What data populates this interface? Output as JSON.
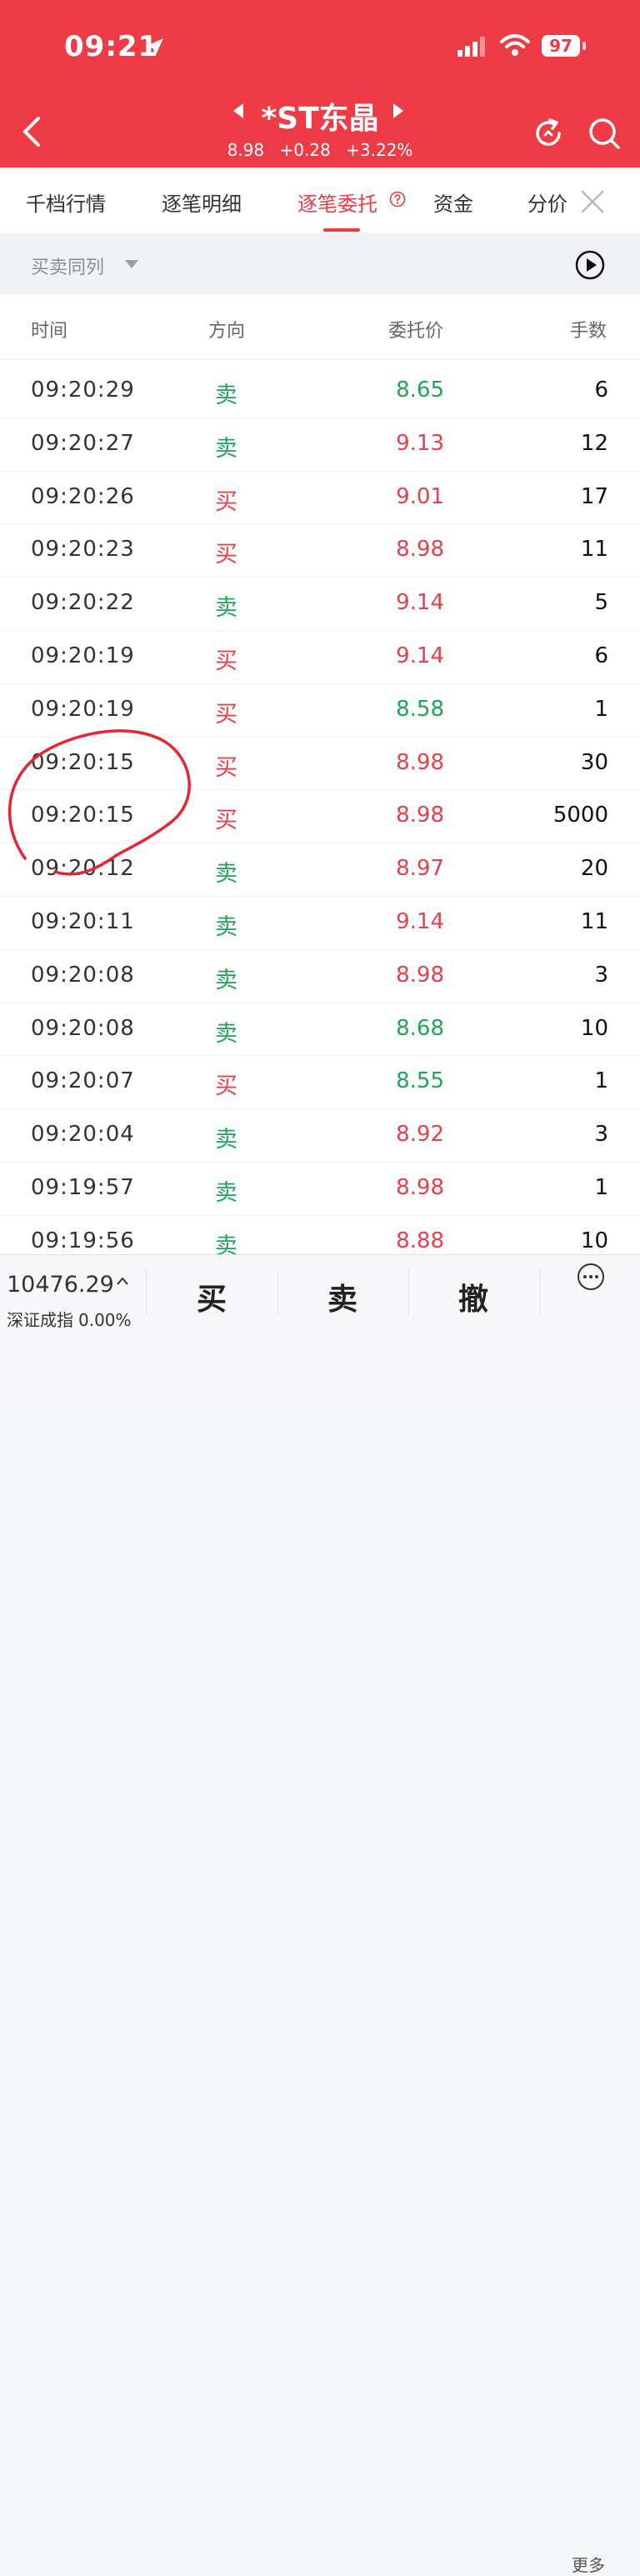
{
  "status": {
    "time": "09:21",
    "battery": "97"
  },
  "header": {
    "stock_name": "*ST东晶",
    "price": "8.98",
    "change": "+0.28",
    "change_pct": "+3.22%"
  },
  "tabs": [
    {
      "label": "千档行情"
    },
    {
      "label": "逐笔明细"
    },
    {
      "label": "逐笔委托"
    },
    {
      "label": "资金"
    },
    {
      "label": "分价"
    }
  ],
  "filter": {
    "label": "买卖同列"
  },
  "table": {
    "headers": {
      "time": "时间",
      "direction": "方向",
      "price": "委托价",
      "quantity": "手数"
    },
    "rows": [
      {
        "time": "09:20:29",
        "direction": "卖",
        "price": "8.65",
        "quantity": "6"
      },
      {
        "time": "09:20:27",
        "direction": "卖",
        "price": "9.13",
        "quantity": "12"
      },
      {
        "time": "09:20:26",
        "direction": "买",
        "price": "9.01",
        "quantity": "17"
      },
      {
        "time": "09:20:23",
        "direction": "买",
        "price": "8.98",
        "quantity": "11"
      },
      {
        "time": "09:20:22",
        "direction": "卖",
        "price": "9.14",
        "quantity": "5"
      },
      {
        "time": "09:20:19",
        "direction": "买",
        "price": "9.14",
        "quantity": "6"
      },
      {
        "time": "09:20:19",
        "direction": "买",
        "price": "8.58",
        "quantity": "1"
      },
      {
        "time": "09:20:15",
        "direction": "买",
        "price": "8.98",
        "quantity": "30"
      },
      {
        "time": "09:20:15",
        "direction": "买",
        "price": "8.98",
        "quantity": "5000"
      },
      {
        "time": "09:20:12",
        "direction": "卖",
        "price": "8.97",
        "quantity": "20"
      },
      {
        "time": "09:20:11",
        "direction": "卖",
        "price": "9.14",
        "quantity": "11"
      },
      {
        "time": "09:20:08",
        "direction": "卖",
        "price": "8.98",
        "quantity": "3"
      },
      {
        "time": "09:20:08",
        "direction": "卖",
        "price": "8.68",
        "quantity": "10"
      },
      {
        "time": "09:20:07",
        "direction": "买",
        "price": "8.55",
        "quantity": "1"
      },
      {
        "time": "09:20:04",
        "direction": "卖",
        "price": "8.92",
        "quantity": "3"
      },
      {
        "time": "09:19:57",
        "direction": "卖",
        "price": "8.98",
        "quantity": "1"
      },
      {
        "time": "09:19:56",
        "direction": "卖",
        "price": "8.88",
        "quantity": "10"
      }
    ]
  },
  "bottom": {
    "index_value": "10476.29",
    "index_name": "深证成指",
    "index_change": "0.00%",
    "buy": "买",
    "sell": "卖",
    "cancel": "撤",
    "more": "更多"
  },
  "colors": {
    "header_red": "#ef3b45",
    "up_red": "#e8404b",
    "down_green": "#1fa55a"
  }
}
